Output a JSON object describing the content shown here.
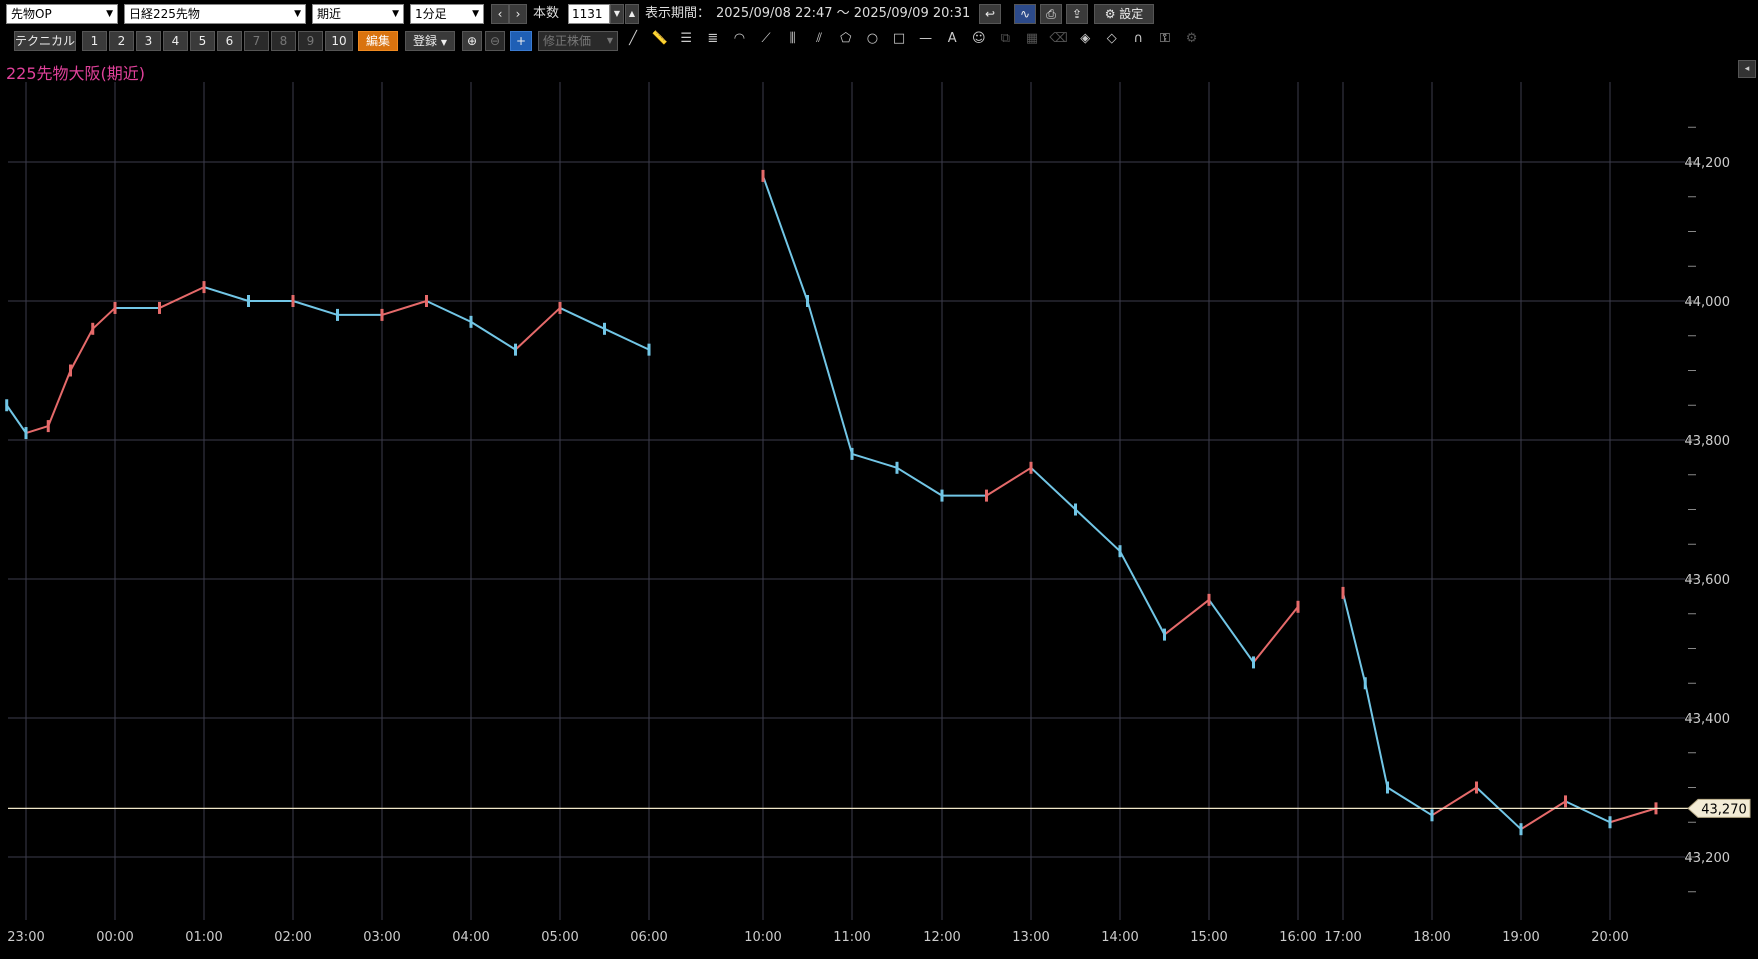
{
  "toolbar": {
    "market_select": "先物OP",
    "instrument_select": "日経225先物",
    "contract_select": "期近",
    "timeframe_select": "1分足",
    "bars_label": "本数",
    "bars_value": "1131",
    "period_label": "表示期間：",
    "period_value": "2025/09/08 22:47 ～ 2025/09/09 20:31",
    "settings_label": "設定",
    "technical_label": "テクニカル",
    "slots": [
      "1",
      "2",
      "3",
      "4",
      "5",
      "6",
      "7",
      "8",
      "9",
      "10"
    ],
    "edit_label": "編集",
    "register_label": "登録",
    "adjusted_label": "修正株価"
  },
  "icons": [
    "line-tool-icon",
    "ruler-icon",
    "horizontal-lines-icon",
    "fibonacci-icon",
    "arc-icon",
    "fan-icon",
    "vertical-lines-icon",
    "channel-icon",
    "pentagon-icon",
    "circle-icon",
    "rectangle-icon",
    "horizontal-line-icon",
    "text-icon",
    "stamp-icon",
    "copy-icon",
    "table-icon",
    "eraser-icon",
    "measure-icon",
    "measure-range-icon",
    "magnet-icon",
    "lock-icon",
    "gear-small-icon"
  ],
  "chart": {
    "title": "225先物大阪(期近)",
    "last_price": "43,270",
    "last_price_value": 43270,
    "colors": {
      "up": "#e56a6a",
      "down": "#72c6e6",
      "grid": "#3c3c4c",
      "last": "#f0e6c8",
      "title": "#e0419a"
    }
  },
  "chart_data": {
    "type": "line",
    "title": "225先物大阪(期近)",
    "ylim": [
      43100,
      44300
    ],
    "y_ticks": [
      "44,200",
      "44,000",
      "43,800",
      "43,600",
      "43,400",
      "43,200"
    ],
    "y_tick_values": [
      44200,
      44000,
      43800,
      43600,
      43400,
      43200
    ],
    "x_ticks": [
      "23:00",
      "00:00",
      "01:00",
      "02:00",
      "03:00",
      "04:00",
      "05:00",
      "06:00",
      "10:00",
      "11:00",
      "12:00",
      "13:00",
      "14:00",
      "15:00",
      "16:00",
      "17:00",
      "18:00",
      "19:00",
      "20:00"
    ],
    "series": [
      {
        "x": [
          "22:47",
          "23:00",
          "23:15",
          "23:30",
          "23:45",
          "00:00",
          "00:30",
          "01:00",
          "01:30",
          "02:00",
          "02:30",
          "03:00",
          "03:30",
          "04:00",
          "04:30",
          "05:00",
          "05:30",
          "06:00",
          "10:00",
          "10:30",
          "11:00",
          "11:30",
          "12:00",
          "12:30",
          "13:00",
          "13:30",
          "14:00",
          "14:30",
          "15:00",
          "15:30",
          "16:00",
          "17:00",
          "17:15",
          "17:30",
          "18:00",
          "18:30",
          "19:00",
          "19:30",
          "20:00",
          "20:31"
        ],
        "y": [
          43850,
          43810,
          43820,
          43900,
          43960,
          43990,
          43990,
          44020,
          44000,
          44000,
          43980,
          43980,
          44000,
          43970,
          43930,
          43990,
          43960,
          43930,
          44180,
          44000,
          43780,
          43760,
          43720,
          43720,
          43760,
          43700,
          43640,
          43520,
          43570,
          43480,
          43560,
          43580,
          43450,
          43300,
          43260,
          43300,
          43240,
          43280,
          43250,
          43270
        ]
      }
    ]
  }
}
